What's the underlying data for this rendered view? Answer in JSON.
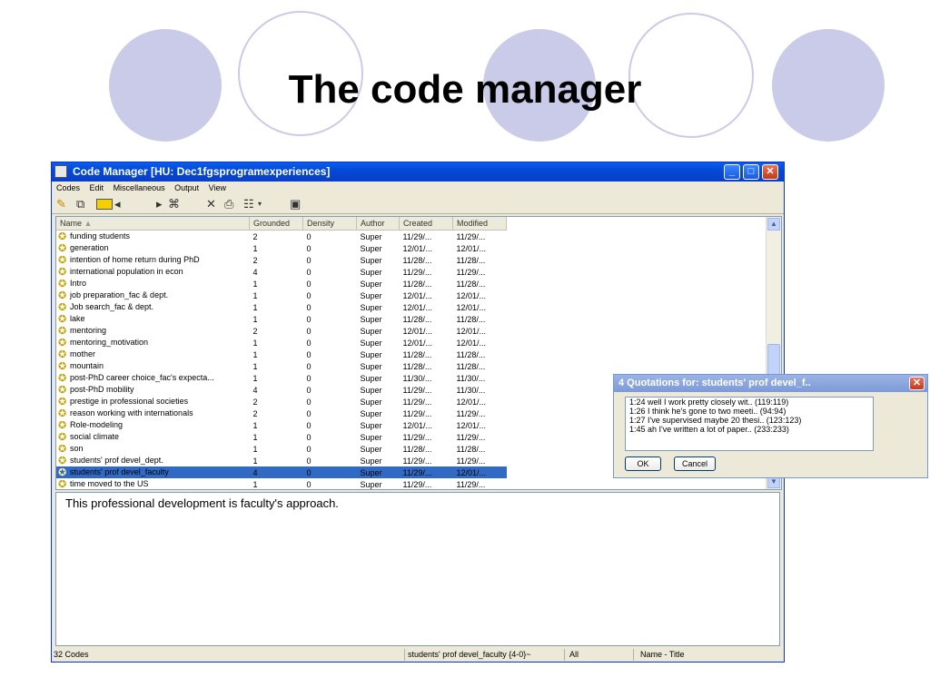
{
  "slide": {
    "title": "The code manager"
  },
  "window": {
    "title": "Code Manager [HU: Dec1fgsprogramexperiences]",
    "menu": [
      "Codes",
      "Edit",
      "Miscellaneous",
      "Output",
      "View"
    ],
    "toolbar_icons": [
      "new-code-icon",
      "code-link-icon",
      "color-box-icon",
      "prev-icon",
      "next-icon",
      "network-icon",
      "delete-icon",
      "print-icon",
      "view-options-icon",
      "dropdown-icon",
      "display-icon"
    ]
  },
  "table": {
    "columns": [
      "Name",
      "Grounded",
      "Density",
      "Author",
      "Created",
      "Modified"
    ],
    "rows": [
      {
        "name": "funding students",
        "grounded": "2",
        "density": "0",
        "author": "Super",
        "created": "11/29/...",
        "modified": "11/29/..."
      },
      {
        "name": "generation",
        "grounded": "1",
        "density": "0",
        "author": "Super",
        "created": "12/01/...",
        "modified": "12/01/..."
      },
      {
        "name": "intention of home return during PhD",
        "grounded": "2",
        "density": "0",
        "author": "Super",
        "created": "11/28/...",
        "modified": "11/28/..."
      },
      {
        "name": "international population in econ",
        "grounded": "4",
        "density": "0",
        "author": "Super",
        "created": "11/29/...",
        "modified": "11/29/..."
      },
      {
        "name": "Intro",
        "grounded": "1",
        "density": "0",
        "author": "Super",
        "created": "11/28/...",
        "modified": "11/28/..."
      },
      {
        "name": "job preparation_fac & dept.",
        "grounded": "1",
        "density": "0",
        "author": "Super",
        "created": "12/01/...",
        "modified": "12/01/..."
      },
      {
        "name": "Job search_fac & dept.",
        "grounded": "1",
        "density": "0",
        "author": "Super",
        "created": "12/01/...",
        "modified": "12/01/..."
      },
      {
        "name": "lake",
        "grounded": "1",
        "density": "0",
        "author": "Super",
        "created": "11/28/...",
        "modified": "11/28/..."
      },
      {
        "name": "mentoring",
        "grounded": "2",
        "density": "0",
        "author": "Super",
        "created": "12/01/...",
        "modified": "12/01/..."
      },
      {
        "name": "mentoring_motivation",
        "grounded": "1",
        "density": "0",
        "author": "Super",
        "created": "12/01/...",
        "modified": "12/01/..."
      },
      {
        "name": "mother",
        "grounded": "1",
        "density": "0",
        "author": "Super",
        "created": "11/28/...",
        "modified": "11/28/..."
      },
      {
        "name": "mountain",
        "grounded": "1",
        "density": "0",
        "author": "Super",
        "created": "11/28/...",
        "modified": "11/28/..."
      },
      {
        "name": "post-PhD career choice_fac's expecta...",
        "grounded": "1",
        "density": "0",
        "author": "Super",
        "created": "11/30/...",
        "modified": "11/30/..."
      },
      {
        "name": "post-PhD mobility",
        "grounded": "4",
        "density": "0",
        "author": "Super",
        "created": "11/29/...",
        "modified": "11/30/..."
      },
      {
        "name": "prestige in professional societies",
        "grounded": "2",
        "density": "0",
        "author": "Super",
        "created": "11/29/...",
        "modified": "12/01/..."
      },
      {
        "name": "reason working with internationals",
        "grounded": "2",
        "density": "0",
        "author": "Super",
        "created": "11/29/...",
        "modified": "11/29/..."
      },
      {
        "name": "Role-modeling",
        "grounded": "1",
        "density": "0",
        "author": "Super",
        "created": "12/01/...",
        "modified": "12/01/..."
      },
      {
        "name": "social climate",
        "grounded": "1",
        "density": "0",
        "author": "Super",
        "created": "11/29/...",
        "modified": "11/29/..."
      },
      {
        "name": "son",
        "grounded": "1",
        "density": "0",
        "author": "Super",
        "created": "11/28/...",
        "modified": "11/28/..."
      },
      {
        "name": "students' prof devel_dept.",
        "grounded": "1",
        "density": "0",
        "author": "Super",
        "created": "11/29/...",
        "modified": "11/29/..."
      },
      {
        "name": "students' prof devel_faculty",
        "grounded": "4",
        "density": "0",
        "author": "Super",
        "created": "11/29/...",
        "modified": "12/01/...",
        "selected": true
      },
      {
        "name": "time moved to the US",
        "grounded": "1",
        "density": "0",
        "author": "Super",
        "created": "11/29/...",
        "modified": "11/29/..."
      }
    ]
  },
  "comment": {
    "text": "This professional development is faculty's approach."
  },
  "status": {
    "count": "32 Codes",
    "selection": "students' prof devel_faculty {4-0}~",
    "filter": "All",
    "sort": "Name - Title"
  },
  "dialog": {
    "title": "4 Quotations for: students' prof devel_f..",
    "quotes": [
      "1:24 well I work pretty closely wit.. (119:119)",
      "1:26 I think he's gone to two meeti.. (94:94)",
      "1:27 I've supervised maybe 20 thesi.. (123:123)",
      "1:45 ah I've written a lot of paper.. (233:233)"
    ],
    "ok_label": "OK",
    "cancel_label": "Cancel"
  },
  "colors": {
    "accent": "#c9cbe8",
    "selection": "#316ac5",
    "titlebar": "#0449d8"
  }
}
